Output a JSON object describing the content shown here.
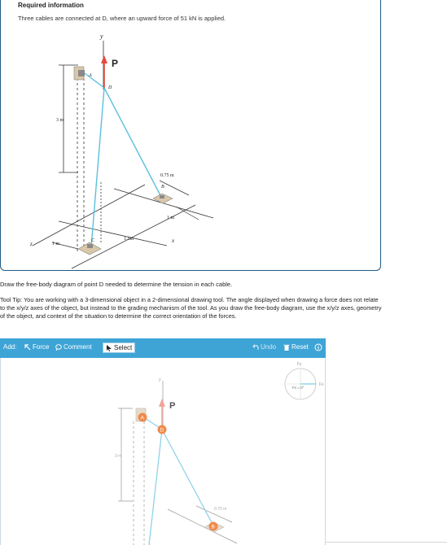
{
  "info": {
    "title": "Required information",
    "text": "Three cables are connected at D, where an upward force of 51 kN is applied."
  },
  "figure": {
    "axis_y": "y",
    "axis_z": "z",
    "axis_x": "x",
    "force_label": "P",
    "point_a": "A",
    "point_b": "B",
    "point_c": "C",
    "point_d": "D",
    "dim_height": "3 m",
    "dim_ab": "0.75 m",
    "dim_b_x": "1 m",
    "dim_c_z": "1 m",
    "dim_c_x": "1.5m"
  },
  "instructions": "Draw the free-body diagram of point D needed to determine the tension in each cable.",
  "tool_tip": "Tool Tip: You are working with a 3-dimensional object in a 2-dimensional drawing tool. The angle displayed when drawing a force does not relate to the x/y/z axes of the object, but instead to the grading mechanism of the tool. As you draw the free-body diagram, use the x/y/z axes, geometry of the object, and context of the situation to determine the correct orientation of the forces.",
  "toolbar": {
    "add_label": "Add:",
    "force_label": "Force",
    "comment_label": "Comment",
    "select_label": "Select",
    "undo_label": "Undo",
    "reset_label": "Reset"
  },
  "compass": {
    "fy_label": "Fy",
    "fx_label": "Fx",
    "readout": "Fx = 0°"
  },
  "canvas_figure": {
    "axis_y": "y",
    "force_label": "P",
    "point_a": "A",
    "point_d": "D",
    "point_b": "B",
    "dim_height": "3 m",
    "dim_ab": "0.75 m"
  },
  "colors": {
    "toolbar": "#3ea4d6",
    "cable": "#5bc0de",
    "force": "#e8483c",
    "point_marker": "#f08a4b",
    "border": "#1f5a84"
  }
}
